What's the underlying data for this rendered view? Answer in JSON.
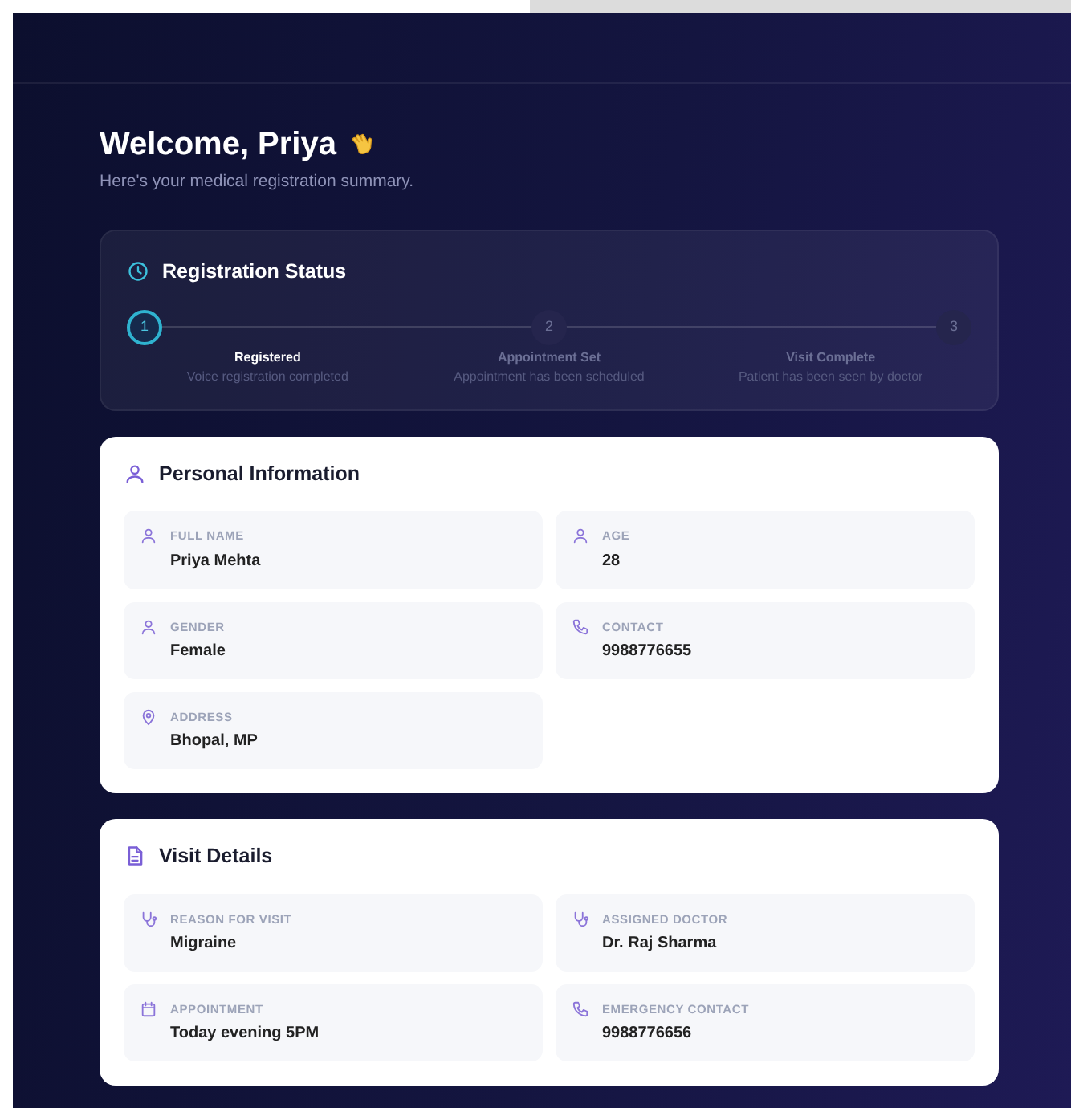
{
  "welcome": {
    "title": "Welcome, Priya",
    "subtitle": "Here's your medical registration summary."
  },
  "registration_status": {
    "title": "Registration Status",
    "steps": [
      {
        "number": "1",
        "label": "Registered",
        "description": "Voice registration completed",
        "selected": true
      },
      {
        "number": "2",
        "label": "Appointment Set",
        "description": "Appointment has been scheduled",
        "selected": false
      },
      {
        "number": "3",
        "label": "Visit Complete",
        "description": "Patient has been seen by doctor",
        "selected": false
      }
    ]
  },
  "sections": [
    {
      "title": "Personal Information",
      "kind": "person",
      "fields": [
        {
          "kind": "person",
          "label": "FULL NAME",
          "value": "Priya Mehta"
        },
        {
          "kind": "person",
          "label": "AGE",
          "value": "28"
        },
        {
          "kind": "person",
          "label": "GENDER",
          "value": "Female"
        },
        {
          "kind": "phone",
          "label": "CONTACT",
          "value": "9988776655"
        },
        {
          "kind": "pin",
          "label": "ADDRESS",
          "value": "Bhopal, MP"
        }
      ]
    },
    {
      "title": "Visit Details",
      "kind": "document",
      "fields": [
        {
          "kind": "stethoscope",
          "label": "REASON FOR VISIT",
          "value": "Migraine"
        },
        {
          "kind": "stethoscope",
          "label": "ASSIGNED DOCTOR",
          "value": "Dr. Raj Sharma"
        },
        {
          "kind": "calendar",
          "label": "APPOINTMENT",
          "value": "Today evening 5PM"
        },
        {
          "kind": "phone",
          "label": "EMERGENCY CONTACT",
          "value": "9988776656"
        }
      ]
    }
  ]
}
